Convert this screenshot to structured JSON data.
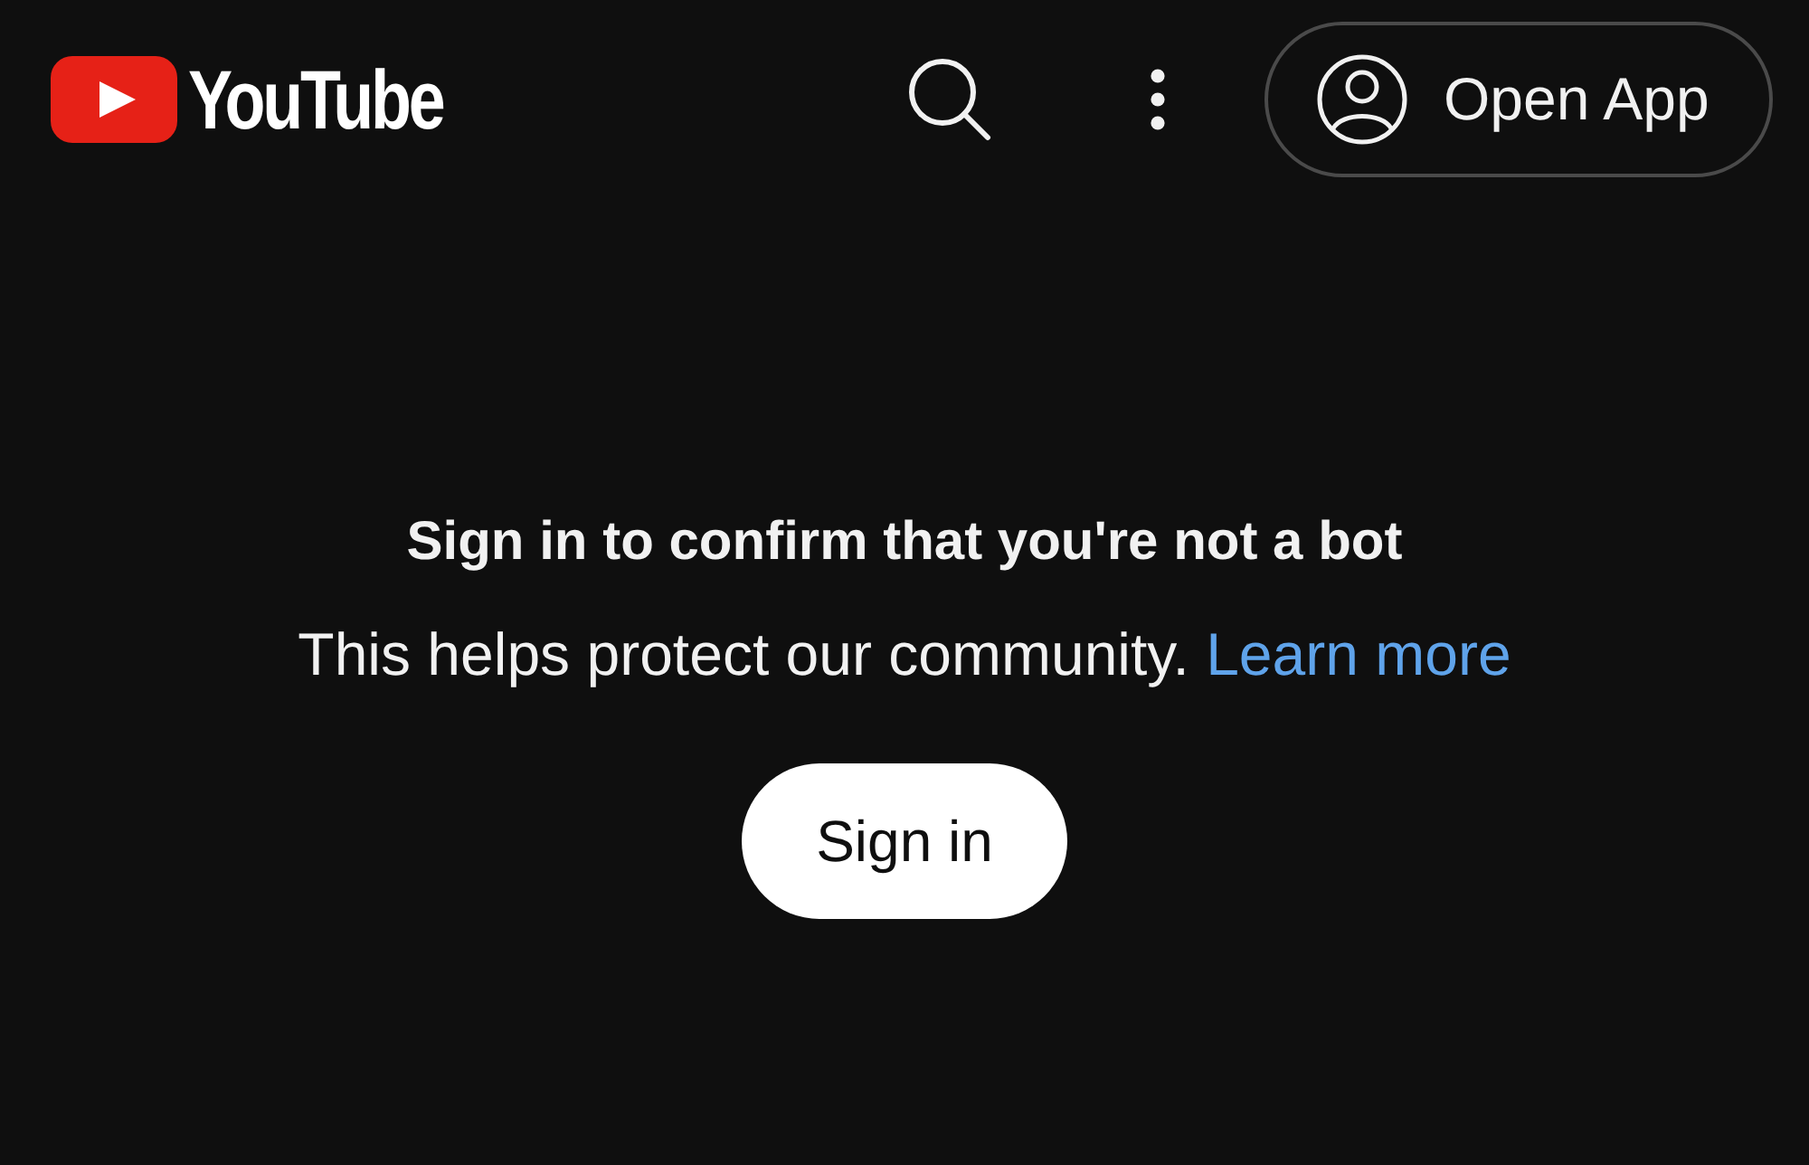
{
  "header": {
    "logo": {
      "text": "YouTube"
    },
    "open_app_button": {
      "label": "Open App"
    }
  },
  "prompt": {
    "title": "Sign in to confirm that you're not a bot",
    "message": "This helps protect our community.",
    "link": "Learn more",
    "button": "Sign in"
  }
}
